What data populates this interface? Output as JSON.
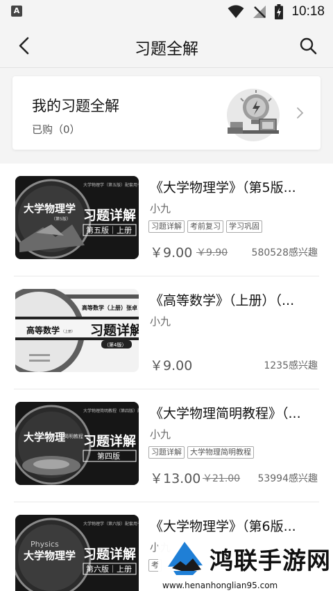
{
  "status_bar": {
    "app_icon_letter": "A",
    "time": "10:18"
  },
  "app_bar": {
    "title": "习题全解",
    "back_icon": "back-arrow-icon",
    "search_icon": "search-icon"
  },
  "my_solutions": {
    "title": "我的习题全解",
    "subtitle": "已购（0）"
  },
  "books": [
    {
      "title": "《大学物理学》（第5版...",
      "author": "小九",
      "tags": [
        "习题详解",
        "考前复习",
        "学习巩固"
      ],
      "price": "￥9.00",
      "original_price": "￥9.90",
      "interest": "580528感兴趣",
      "cover": {
        "title": "大学物理学",
        "edition_note": "（第5版）",
        "subtitle": "习题详解",
        "band": "第五版｜上册",
        "top_text": "大学物理学（第五版）配套用书"
      }
    },
    {
      "title": "《高等数学》（上册）（...",
      "author": "小九",
      "tags": [],
      "price": "￥9.00",
      "original_price": "",
      "interest": "1235感兴趣",
      "cover": {
        "title": "高等数学",
        "edition_note": "（上册）",
        "subtitle": "习题详解",
        "band": "（第4版）",
        "top_text": "高等数学（上册）张卓"
      }
    },
    {
      "title": "《大学物理简明教程》（...",
      "author": "小九",
      "tags": [
        "习题详解",
        "大学物理简明教程"
      ],
      "price": "￥13.00",
      "original_price": "￥21.00",
      "interest": "53994感兴趣",
      "cover": {
        "title": "大学物理",
        "edition_note": "简明教程",
        "subtitle": "习题详解",
        "band": "第四版",
        "top_text": "大学物理简明教程（第四版）配套用书"
      }
    },
    {
      "title": "《大学物理学》（第6版...",
      "author": "小九",
      "tags": [
        "考"
      ],
      "price": "",
      "original_price": "",
      "interest": "",
      "cover": {
        "title": "大学物理学",
        "edition_note": "Physics",
        "subtitle": "习题详解",
        "band": "第六版｜上册",
        "top_text": "大学物理学（第六版）配套用书"
      }
    }
  ],
  "watermark": {
    "text": "鸿联手游网",
    "url": "www.henanhonglian95.com"
  }
}
